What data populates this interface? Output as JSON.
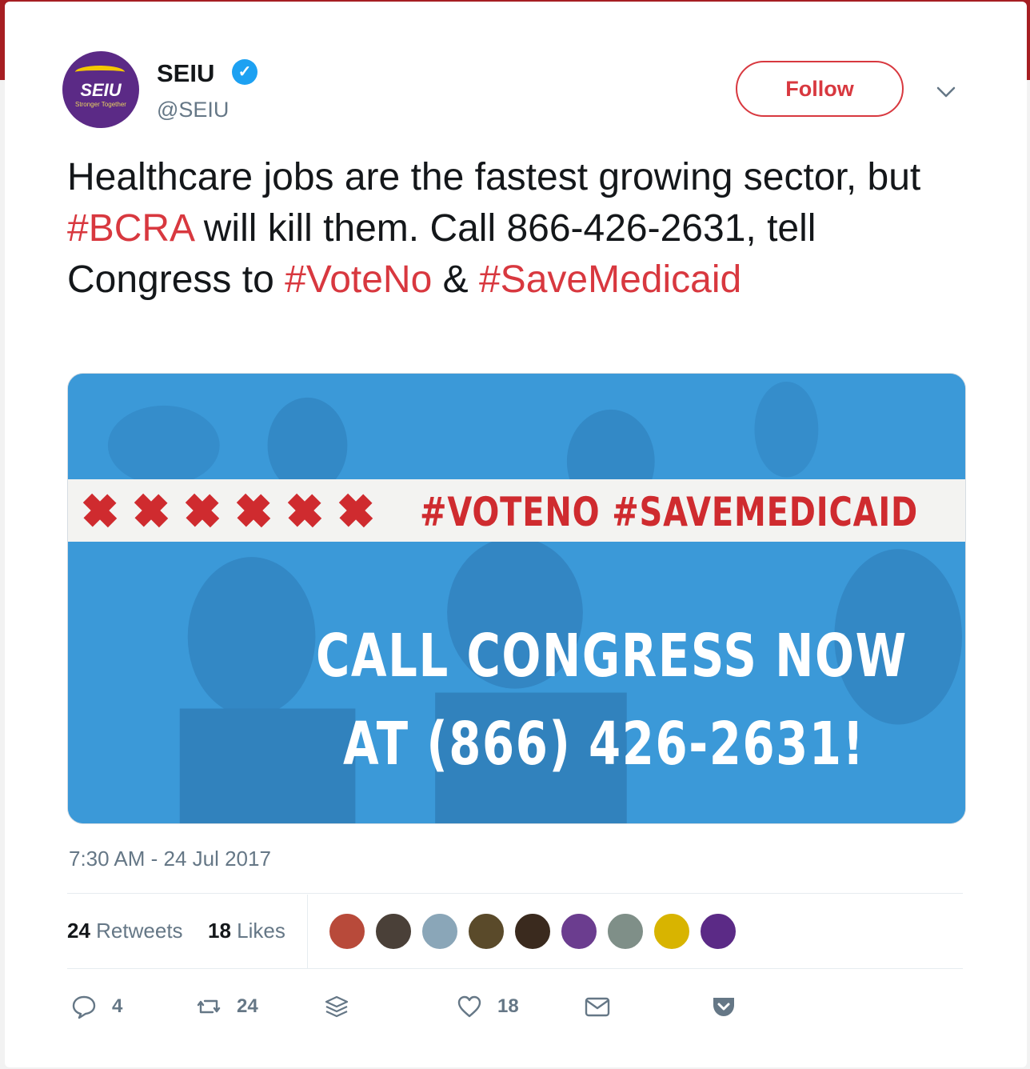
{
  "account": {
    "display_name": "SEIU",
    "handle": "@SEIU",
    "avatar_text": "SEIU",
    "avatar_subtext": "Stronger Together",
    "verified_icon": "verified-badge-icon"
  },
  "follow_label": "Follow",
  "tweet": {
    "part1": "Healthcare jobs are the fastest growing sector, but ",
    "tag1": "#BCRA",
    "part2": " will kill them. Call 866-426-2631, tell Congress to ",
    "tag2": "#VoteNo",
    "part3": " & ",
    "tag3": "#SaveMedicaid"
  },
  "media": {
    "banner_tags": "#VOTENO  #SAVEMEDICAID",
    "line1": "CALL CONGRESS NOW",
    "line2": "AT (866) 426-2631!"
  },
  "timestamp": "7:30 AM - 24 Jul 2017",
  "stats": {
    "retweets_count": "24",
    "retweets_label": "Retweets",
    "likes_count": "18",
    "likes_label": "Likes"
  },
  "likers": [
    {
      "color": "#b84a3a"
    },
    {
      "color": "#4a4038"
    },
    {
      "color": "#8aa6b8"
    },
    {
      "color": "#5a4a2a"
    },
    {
      "color": "#3a2a1e"
    },
    {
      "color": "#6b3d8f"
    },
    {
      "color": "#7f8f88"
    },
    {
      "color": "#d8b400"
    },
    {
      "color": "#5b2a86"
    }
  ],
  "actions": {
    "replies": "4",
    "retweets": "24",
    "likes": "18"
  },
  "colors": {
    "accent": "#d8383f",
    "muted": "#657786",
    "text": "#14171a",
    "media_blue": "#3b99d8"
  }
}
